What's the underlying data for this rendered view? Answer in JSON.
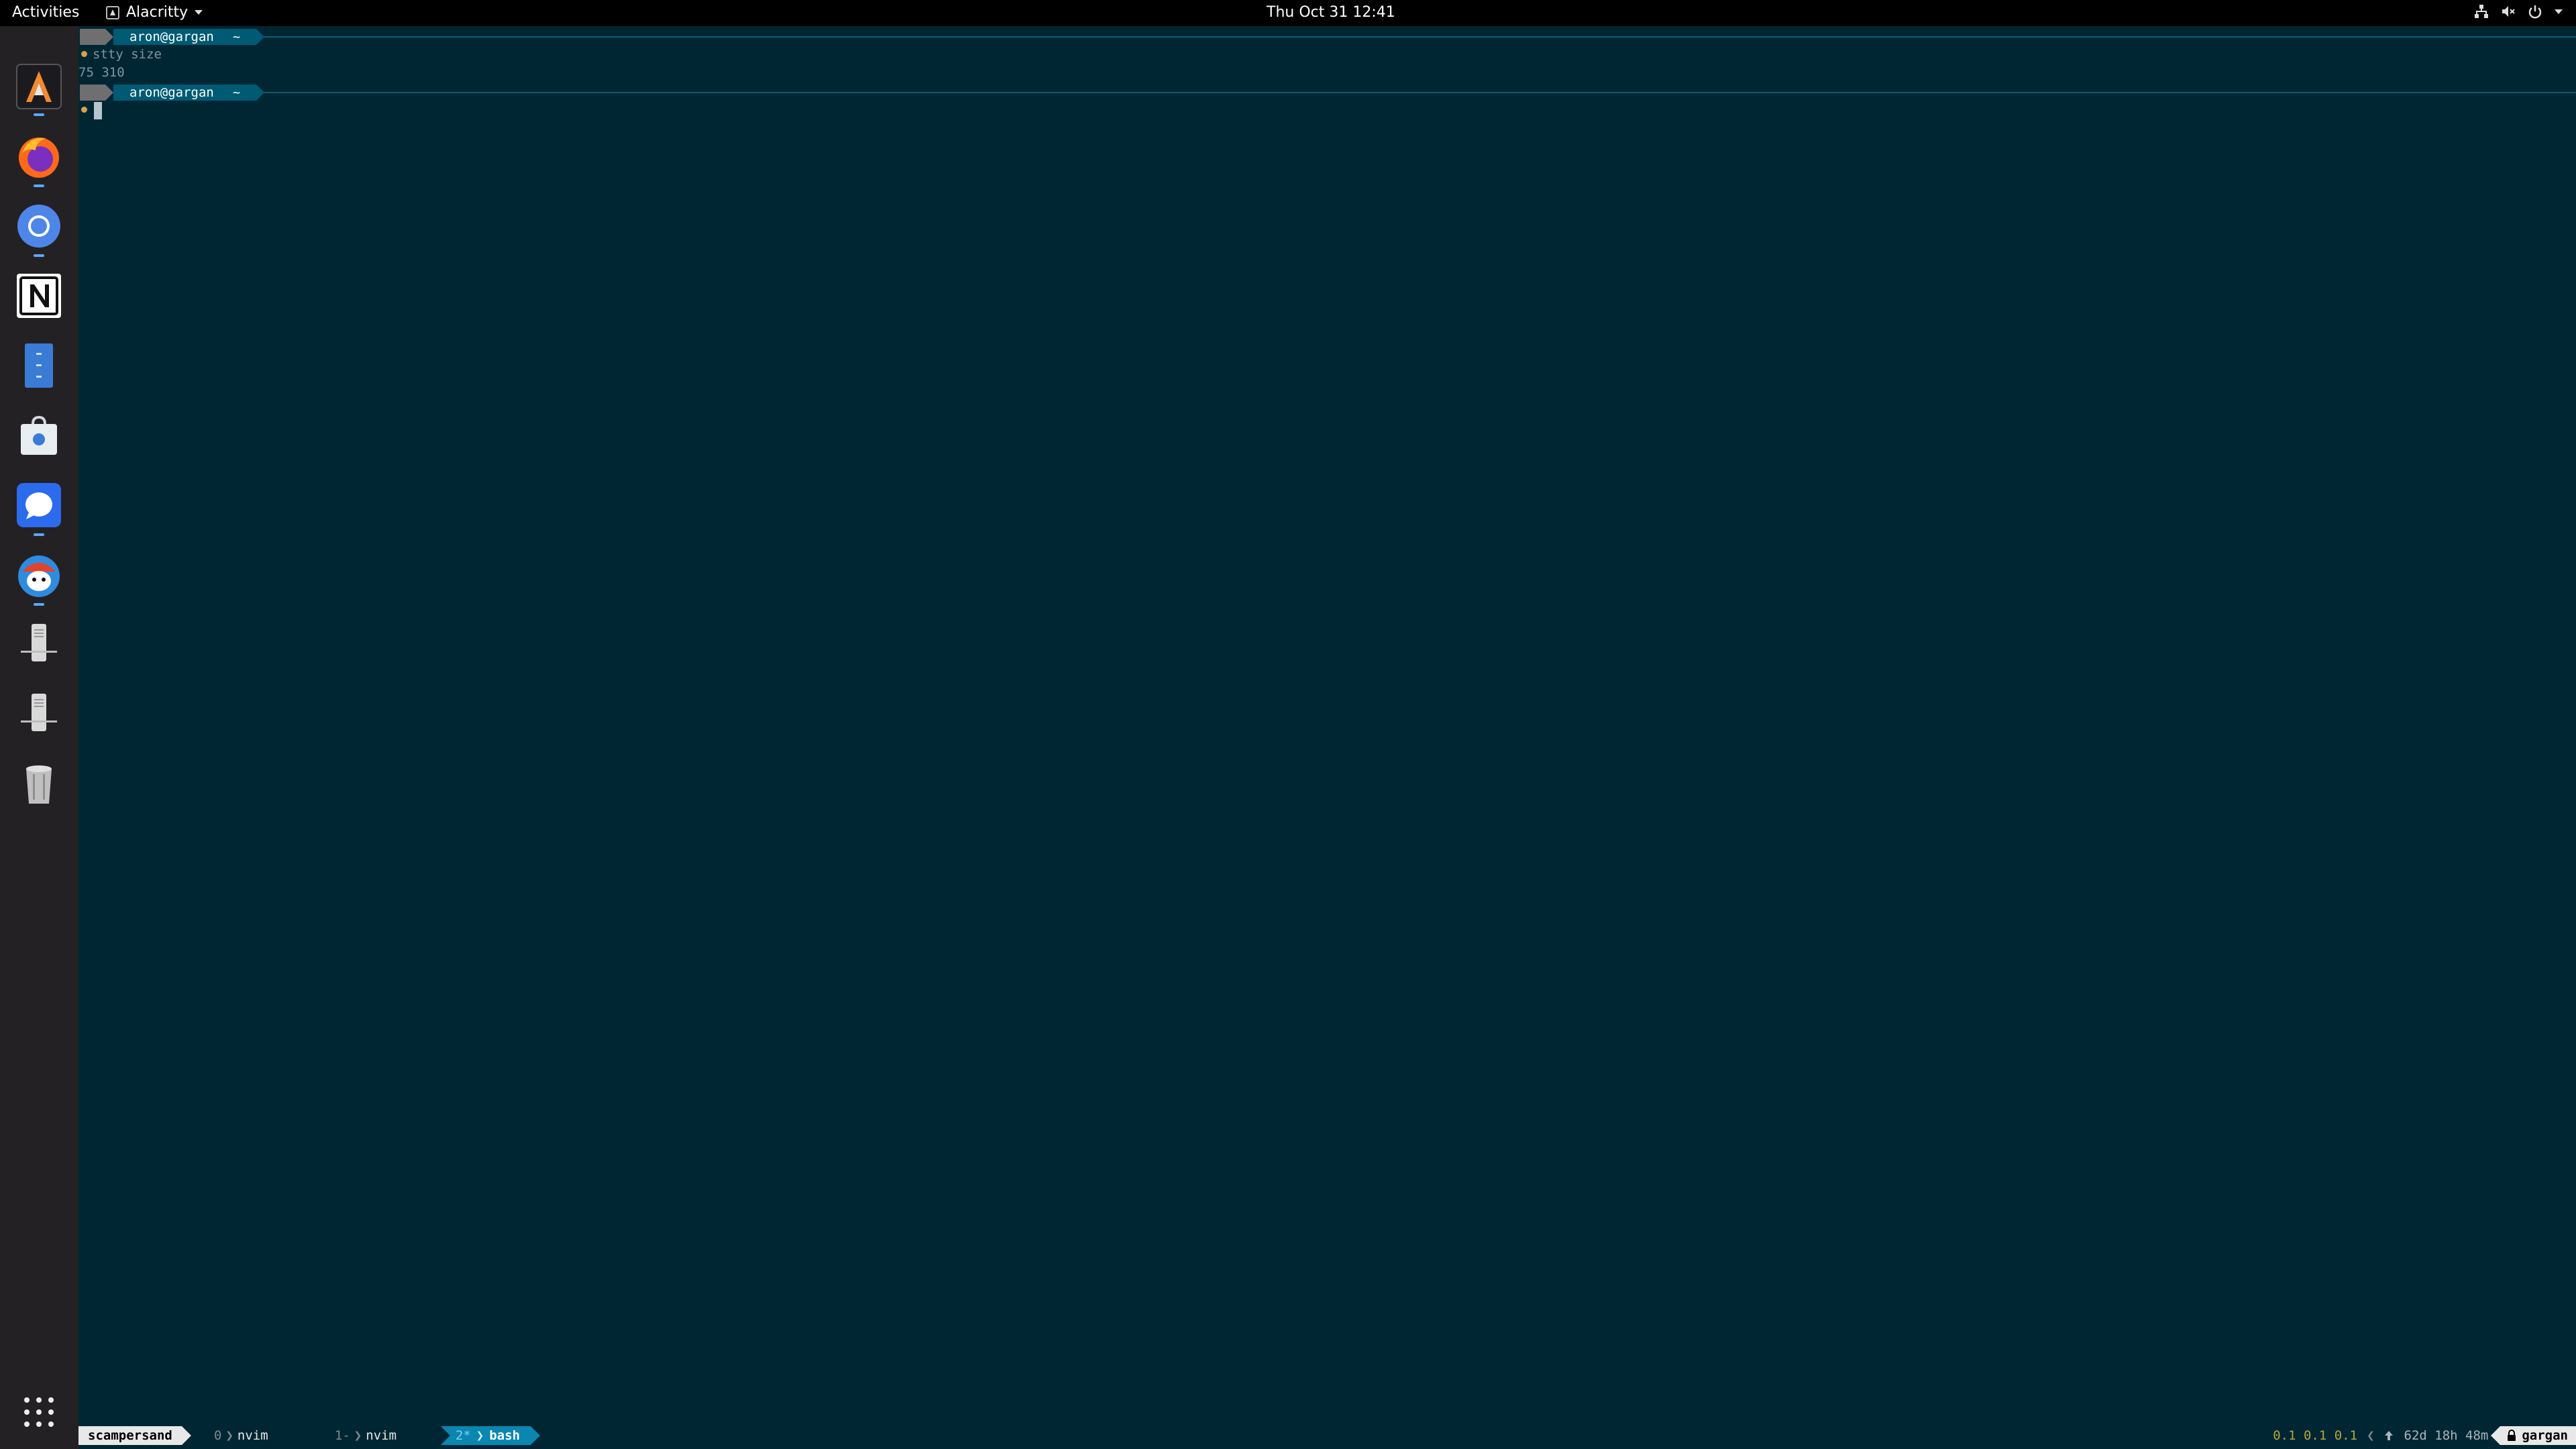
{
  "topbar": {
    "activities": "Activities",
    "app_name": "Alacritty",
    "clock": "Thu Oct 31  12:41",
    "tray_icons": [
      "network-icon",
      "volume-muted-icon",
      "power-icon",
      "chevron-down-icon"
    ]
  },
  "dock": {
    "items": [
      {
        "name": "alacritty-icon",
        "running": true
      },
      {
        "name": "firefox-icon",
        "running": true
      },
      {
        "name": "chromium-icon",
        "running": true
      },
      {
        "name": "notion-icon",
        "running": false
      },
      {
        "name": "files-icon",
        "running": false
      },
      {
        "name": "software-store-icon",
        "running": false
      },
      {
        "name": "signal-icon",
        "running": true
      },
      {
        "name": "app-mascot-icon",
        "running": true
      },
      {
        "name": "removable-drive-icon",
        "running": false
      },
      {
        "name": "removable-drive-icon",
        "running": false
      },
      {
        "name": "trash-icon",
        "running": false
      },
      {
        "name": "app-grid-icon",
        "running": false
      }
    ]
  },
  "terminal": {
    "prompt1": {
      "user_host": "aron@gargan",
      "cwd": "~"
    },
    "command": "stty size",
    "output": "75 310",
    "prompt2": {
      "user_host": "aron@gargan",
      "cwd": "~"
    }
  },
  "statusbar": {
    "session": "scampersand",
    "windows": [
      {
        "index": "0",
        "flag": "",
        "name": "nvim"
      },
      {
        "index": "1",
        "flag": "-",
        "name": "nvim"
      }
    ],
    "active_window": {
      "index": "2",
      "flag": "*",
      "name": "bash"
    },
    "load": "0.1 0.1 0.1",
    "uptime": "62d 18h 48m",
    "hostname": "gargan"
  }
}
